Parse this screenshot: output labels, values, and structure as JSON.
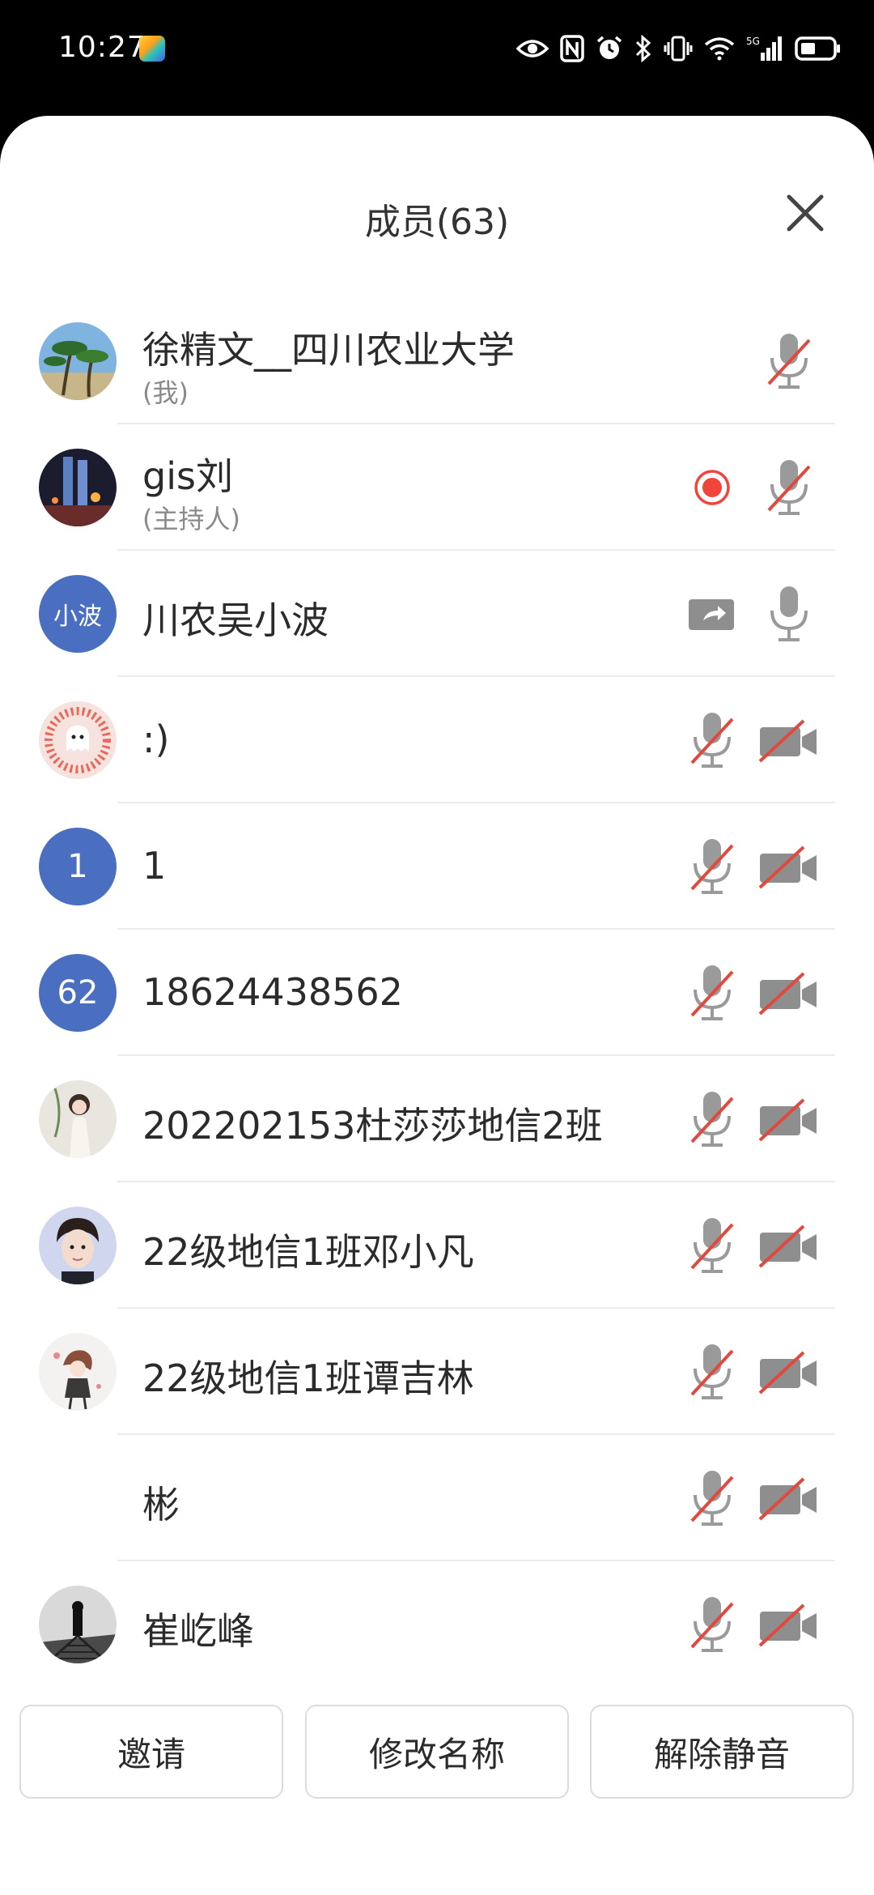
{
  "status_bar": {
    "time": "10:27",
    "network": "5G"
  },
  "sheet": {
    "title": "成员(63)"
  },
  "members": [
    {
      "name": "徐精文__四川农业大学",
      "sub": "(我)",
      "avatar": "photo-palms",
      "mic": "muted"
    },
    {
      "name": "gis刘",
      "sub": "(主持人)",
      "avatar": "photo-city",
      "mic": "muted",
      "recording": true
    },
    {
      "name": "川农吴小波",
      "avatar_text": "小波",
      "mic": "on",
      "sharing": true
    },
    {
      "name": ":)",
      "avatar": "photo-ghost",
      "mic": "muted",
      "camera": "off"
    },
    {
      "name": "1",
      "avatar_text": "1",
      "mic": "muted",
      "camera": "off"
    },
    {
      "name": "18624438562",
      "avatar_text": "62",
      "mic": "muted",
      "camera": "off"
    },
    {
      "name": "202202153杜莎莎地信2班",
      "avatar": "photo-woman",
      "mic": "muted",
      "camera": "off"
    },
    {
      "name": "22级地信1班邓小凡",
      "avatar": "photo-boy",
      "mic": "muted",
      "camera": "off"
    },
    {
      "name": "22级地信1班谭吉林",
      "avatar": "photo-anime",
      "mic": "muted",
      "camera": "off"
    },
    {
      "name": "彬",
      "mic": "muted",
      "camera": "off"
    },
    {
      "name": "崔屹峰",
      "avatar": "photo-bw",
      "mic": "muted",
      "camera": "off"
    }
  ],
  "buttons": {
    "invite": "邀请",
    "rename": "修改名称",
    "unmute": "解除静音"
  },
  "colors": {
    "accent_blue": "#4a6fc0",
    "mute_red": "#e0493e",
    "record_red": "#f0453a",
    "icon_gray": "#9a9a9a"
  }
}
